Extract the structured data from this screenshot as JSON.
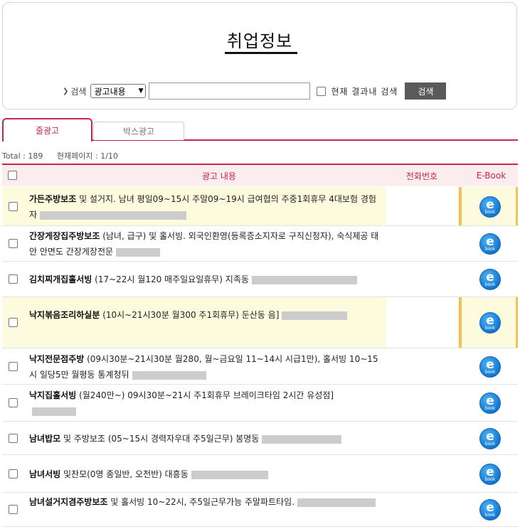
{
  "header": {
    "title": "취업정보"
  },
  "search": {
    "label": "검색",
    "select_value": "광고내용",
    "input_value": "",
    "within_label": "현재 결과내 검색",
    "button_label": "검색"
  },
  "tabs": [
    {
      "label": "줄광고",
      "active": true
    },
    {
      "label": "박스광고",
      "active": false
    }
  ],
  "meta": {
    "total": "Total : 189",
    "page": "현재페이지 : 1/10"
  },
  "table": {
    "columns": {
      "content": "광고 내용",
      "phone": "전화번호",
      "ebook": "E-Book"
    },
    "ebook_icon": {
      "letter": "e",
      "word": "book"
    },
    "rows": [
      {
        "title": "가든주방보조",
        "text": " 및 설거지. 남녀 평일09~15시 주말09~19시 급여협의 주중1회휴무 4대보험 경험자",
        "highlight": true
      },
      {
        "title": "간장게장집주방보조",
        "text": " (남녀, 급구) 및 홀서빙. 외국인환영(등록증소지자로 구직신청자), 숙식제공 태안 안면도 간장게장전문",
        "highlight": false
      },
      {
        "title": "김치찌개집홀서빙",
        "text": " (17~22시 월120 매주일요일휴무) 지족동",
        "highlight": false
      },
      {
        "title": "낙지볶음조리하실분",
        "text": " (10시~21시30분 월300 주1회휴무) 둔산동 음]",
        "highlight": true
      },
      {
        "title": "낙지전문점주방",
        "text": " (09시30분~21시30분 월280, 월~금요일 11~14시 시급1만), 홀서빙 10~15시 일당5만 월평동 통계청뒤",
        "highlight": false
      },
      {
        "title": "낙지집홀서빙",
        "text": " (월240만~) 09시30분~21시 주1회휴무 브레이크타임 2시간 유성점]",
        "highlight": false
      },
      {
        "title": "남녀밥모",
        "text": " 및 주방보조 (05~15시 경력자우대 주5일근무) 봉명동",
        "highlight": false
      },
      {
        "title": "남녀서빙",
        "text": " 및찬모(0명 종일반, 오전반) 대흥동",
        "highlight": false
      },
      {
        "title": "남녀설거지겸주방보조",
        "text": " 및 홀서빙 10~22시, 주5일근무가능 주말파트타임.",
        "highlight": false
      }
    ]
  }
}
